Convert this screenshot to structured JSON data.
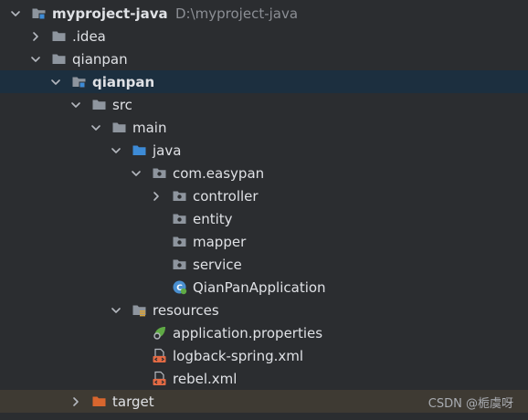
{
  "tree": [
    {
      "label": "myproject-java",
      "hint": "D:\\myproject-java",
      "bold": true,
      "expanded": true,
      "icon": "module-folder-icon",
      "chevron": "chevron-down"
    },
    {
      "label": ".idea",
      "expanded": false,
      "icon": "folder-icon",
      "chevron": "chevron-right"
    },
    {
      "label": "qianpan",
      "expanded": true,
      "icon": "folder-icon",
      "chevron": "chevron-down"
    },
    {
      "label": "qianpan",
      "bold": true,
      "expanded": true,
      "icon": "module-folder-icon",
      "chevron": "chevron-down",
      "selected": true
    },
    {
      "label": "src",
      "expanded": true,
      "icon": "folder-icon",
      "chevron": "chevron-down"
    },
    {
      "label": "main",
      "expanded": true,
      "icon": "folder-icon",
      "chevron": "chevron-down"
    },
    {
      "label": "java",
      "expanded": true,
      "icon": "source-root-folder-icon",
      "chevron": "chevron-down"
    },
    {
      "label": "com.easypan",
      "expanded": true,
      "icon": "package-icon",
      "chevron": "chevron-down"
    },
    {
      "label": "controller",
      "expanded": false,
      "icon": "package-icon",
      "chevron": "chevron-right"
    },
    {
      "label": "entity",
      "icon": "package-icon",
      "chevron": ""
    },
    {
      "label": "mapper",
      "icon": "package-icon",
      "chevron": ""
    },
    {
      "label": "service",
      "icon": "package-icon",
      "chevron": ""
    },
    {
      "label": "QianPanApplication",
      "icon": "spring-boot-class-icon",
      "chevron": ""
    },
    {
      "label": "resources",
      "expanded": true,
      "icon": "resources-root-folder-icon",
      "chevron": "chevron-down"
    },
    {
      "label": "application.properties",
      "icon": "spring-properties-icon",
      "chevron": ""
    },
    {
      "label": "logback-spring.xml",
      "icon": "xml-file-icon",
      "chevron": ""
    },
    {
      "label": "rebel.xml",
      "icon": "xml-file-icon",
      "chevron": ""
    },
    {
      "label": "target",
      "expanded": false,
      "icon": "excluded-folder-icon",
      "chevron": "chevron-right",
      "highlight": true
    }
  ],
  "watermark": "CSDN @栀虞呀",
  "colors": {
    "background": "#2b2d30",
    "selected_row": "#1c2f3f",
    "highlight_row": "#3e3a33",
    "text": "#dfe1e5",
    "hint_text": "#8b8e94",
    "folder": "#8e959e",
    "source_root": "#3d8bd6",
    "excluded_folder": "#d9662e",
    "spring": "#5faa45",
    "xml": "#e36a44"
  }
}
